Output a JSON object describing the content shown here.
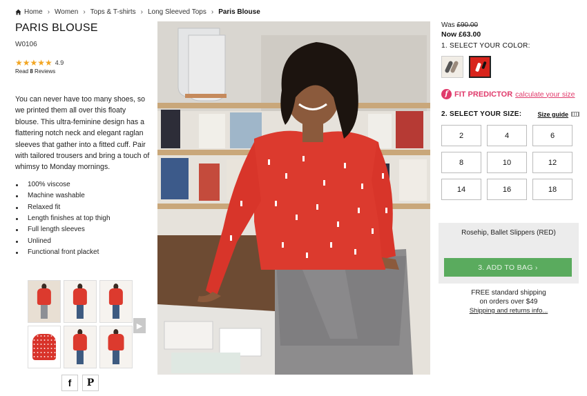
{
  "breadcrumb": {
    "items": [
      "Home",
      "Women",
      "Tops & T-shirts",
      "Long Sleeved Tops"
    ],
    "current": "Paris Blouse"
  },
  "product": {
    "title": "PARIS BLOUSE",
    "sku": "W0106",
    "rating": "4.9",
    "stars": 4.9,
    "reviews_prefix": "Read ",
    "reviews_count": "8",
    "reviews_suffix": " Reviews",
    "description": "You can never have too many shoes, so we printed them all over this floaty blouse. This ultra-feminine design has a flattering notch neck and elegant raglan sleeves that gather into a fitted cuff. Pair with tailored trousers and bring a touch of whimsy to Monday mornings.",
    "features": [
      "100% viscose",
      "Machine washable",
      "Relaxed fit",
      "Length finishes at top thigh",
      "Full length sleeves",
      "Unlined",
      "Functional front placket"
    ]
  },
  "social": {
    "facebook": "f",
    "pinterest": "P"
  },
  "pricing": {
    "was_label": "Was ",
    "was_price": "£90.00",
    "now": "Now £63.00"
  },
  "color": {
    "label": "1. SELECT YOUR COLOR:",
    "selected_name": "Rosehip, Ballet Slippers (RED)"
  },
  "fit": {
    "label": "FIT PREDICTOR",
    "link": "calculate your size"
  },
  "size": {
    "label": "2. SELECT YOUR SIZE:",
    "guide": "Size guide",
    "options": [
      "2",
      "4",
      "6",
      "8",
      "10",
      "12",
      "14",
      "16",
      "18"
    ]
  },
  "cart": {
    "add_label": "3. ADD TO BAG ›"
  },
  "shipping": {
    "line1": "FREE standard shipping",
    "line2": "on orders over $49",
    "link": "Shipping and returns info..."
  },
  "colors": {
    "accent": "#e03a6b",
    "add_button": "#5aab5e",
    "blouse": "#dc3a2e"
  }
}
